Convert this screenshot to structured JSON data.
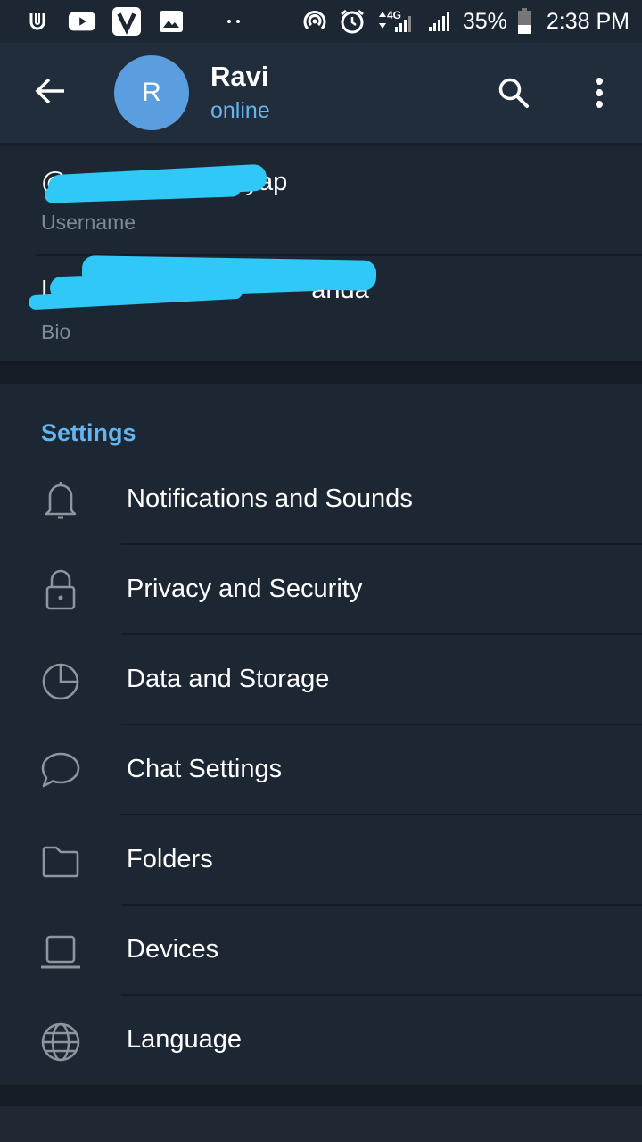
{
  "status_bar": {
    "left_icons": [
      "app-u-icon",
      "youtube-icon",
      "v-app-icon",
      "gallery-icon",
      "more-notifications-icon"
    ],
    "right_icons": [
      "hotspot-icon",
      "alarm-icon",
      "signal-4g-icon",
      "signal-icon",
      "battery-icon"
    ],
    "network_label": "4G",
    "battery": "35%",
    "time": "2:38 PM"
  },
  "header": {
    "avatar_initial": "R",
    "avatar_color": "#5a9ee0",
    "name": "Ravi",
    "status": "online",
    "status_color": "#64b5ef"
  },
  "profile_info": {
    "username": {
      "value_visible_prefix": "@",
      "value_visible_suffix": "yap",
      "label": "Username",
      "redacted": true
    },
    "bio": {
      "value_visible_prefix": "Live",
      "value_visible_suffix": "anda",
      "label": "Bio",
      "redacted": true
    },
    "redaction_color": "#30c8f6"
  },
  "settings": {
    "section_title": "Settings",
    "items": [
      {
        "label": "Notifications and Sounds",
        "icon": "bell-icon"
      },
      {
        "label": "Privacy and Security",
        "icon": "lock-icon"
      },
      {
        "label": "Data and Storage",
        "icon": "pie-chart-icon"
      },
      {
        "label": "Chat Settings",
        "icon": "chat-bubble-icon"
      },
      {
        "label": "Folders",
        "icon": "folder-icon"
      },
      {
        "label": "Devices",
        "icon": "laptop-icon"
      },
      {
        "label": "Language",
        "icon": "globe-icon"
      }
    ]
  },
  "theme": {
    "background": "#1d2733",
    "header_background": "#212d3b",
    "accent": "#64b5ef",
    "secondary_text": "#7d8b99",
    "icon_color": "#8c969f"
  }
}
